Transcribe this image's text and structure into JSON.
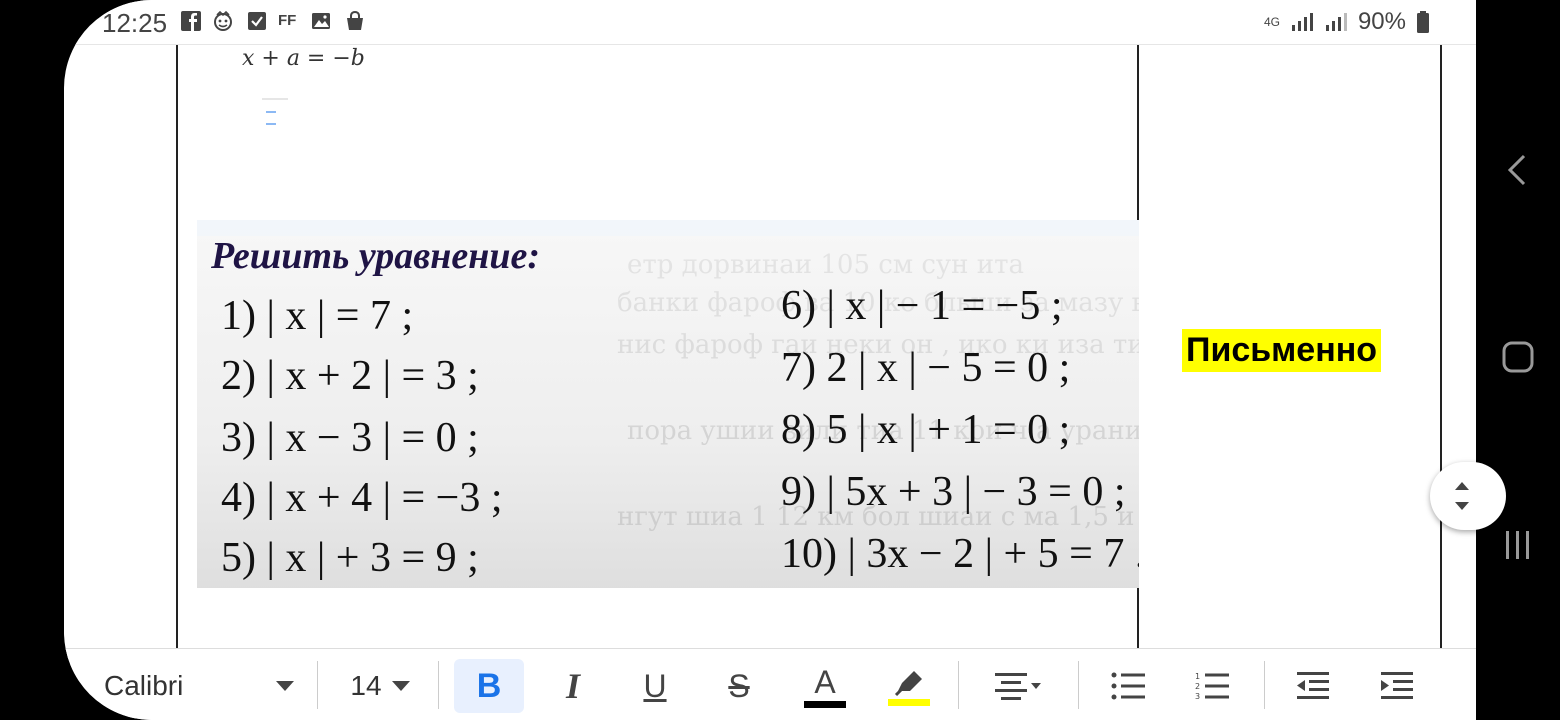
{
  "status_bar": {
    "time": "12:25",
    "battery": "90%",
    "network": "4G",
    "left_icons": [
      "facebook-icon",
      "face-icon",
      "checkbox-icon",
      "ff-icon",
      "image-icon",
      "bag-icon"
    ],
    "ff_label": "FF"
  },
  "document": {
    "cell_equation": "x + a = −b",
    "problem_title": "Решить уравнение:",
    "equations_left": [
      "1) | x | = 7 ;",
      "2) | x + 2 | = 3 ;",
      "3) | x − 3 | = 0 ;",
      "4) | x + 4 | = −3 ;",
      "5) | x | + 3 = 9 ;"
    ],
    "equations_right": [
      "6) | x | − 1 = −5 ;",
      "7) 2 | x | − 5 = 0 ;",
      "8) 5 | x | + 1 = 0 ;",
      "9) | 5x + 3 | − 3 = 0 ;",
      "10) | 3x − 2 | + 5 = 7 ."
    ],
    "side_label": "Письменно"
  },
  "toolbar": {
    "font": "Calibri",
    "size": "14",
    "bold": "B",
    "italic": "I",
    "underline": "U",
    "strike": "S",
    "color": "A",
    "text_color": "#000000",
    "highlight_color": "#ffff00",
    "accent_bg": "#e8f0fe",
    "accent": "#1a73e8"
  }
}
